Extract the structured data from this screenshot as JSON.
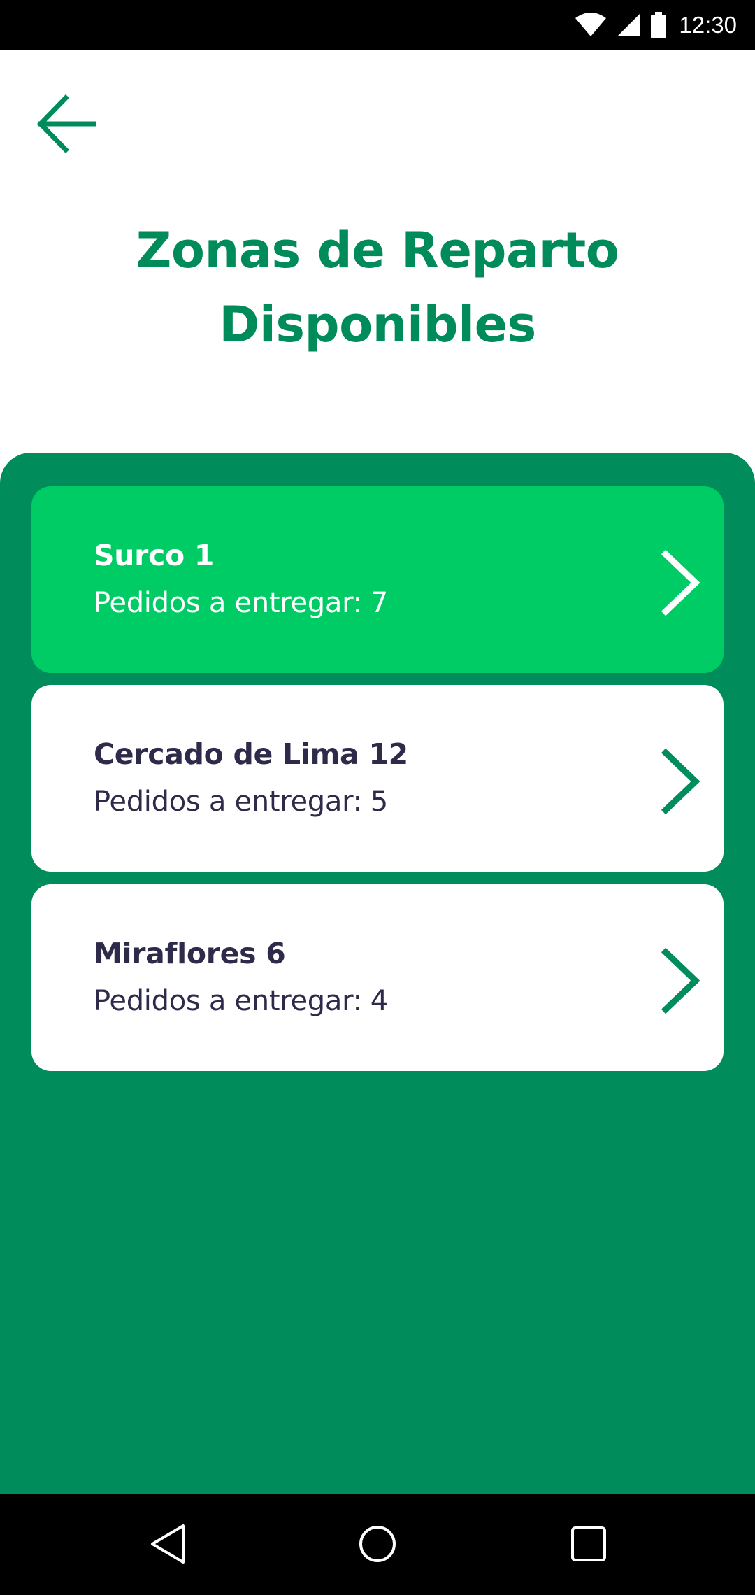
{
  "status_bar": {
    "time": "12:30",
    "icons": [
      "wifi-icon",
      "cell-signal-icon",
      "battery-icon"
    ]
  },
  "header": {
    "back_icon": "arrow-left-icon",
    "title_line1": "Zonas de Reparto",
    "title_line2": "Disponibles"
  },
  "zones": [
    {
      "name": "Surco 1",
      "orders_label": "Pedidos a entregar:",
      "orders_count": "7",
      "selected": true
    },
    {
      "name": "Cercado de Lima 12",
      "orders_label": "Pedidos a entregar:",
      "orders_count": "5",
      "selected": false
    },
    {
      "name": "Miraflores 6",
      "orders_label": "Pedidos a entregar:",
      "orders_count": "4",
      "selected": false
    }
  ],
  "nav_bar": {
    "icons": [
      "back-triangle-icon",
      "home-circle-icon",
      "recents-square-icon"
    ]
  },
  "colors": {
    "brand_green": "#018c5c",
    "title_green": "#008b5a",
    "active_card": "#00cc66",
    "card_text": "#2e2a4a"
  }
}
